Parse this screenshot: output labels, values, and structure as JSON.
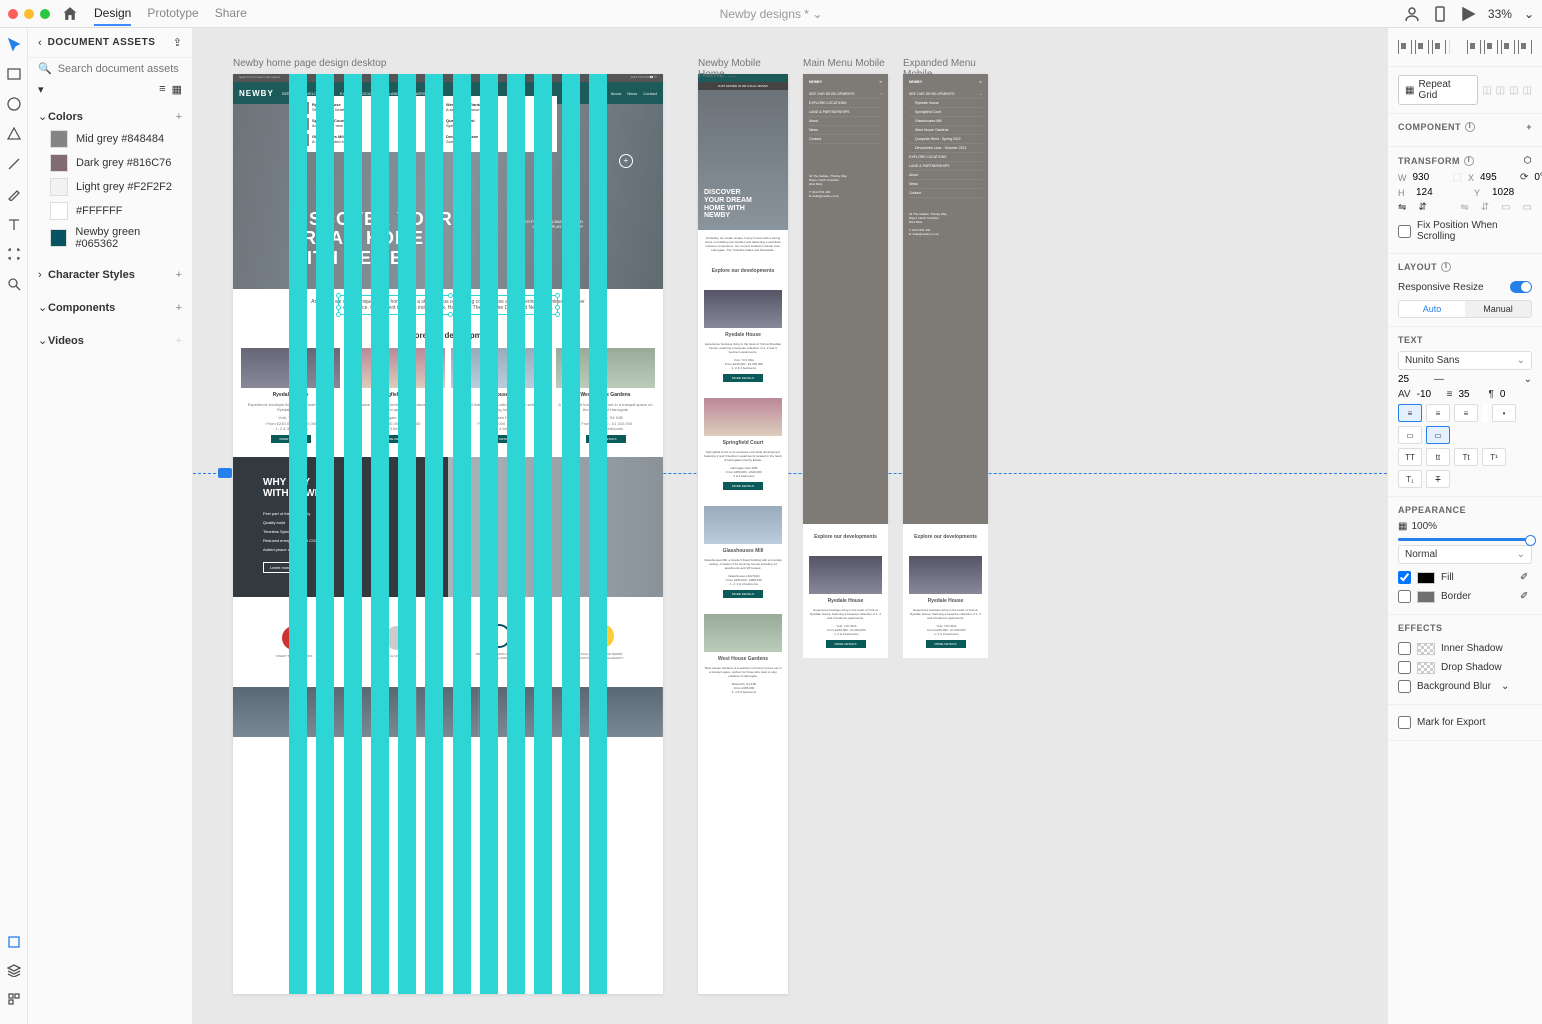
{
  "titlebar": {
    "tabs": [
      "Design",
      "Prototype",
      "Share"
    ],
    "active_tab": "Design",
    "document": "Newby designs *",
    "zoom": "33%"
  },
  "left_panel": {
    "header": "DOCUMENT ASSETS",
    "search_placeholder": "Search document assets",
    "sections": {
      "colors": {
        "title": "Colors",
        "items": [
          {
            "name": "Mid grey #848484",
            "hex": "#848484"
          },
          {
            "name": "Dark grey #816C76",
            "hex": "#816C76"
          },
          {
            "name": "Light grey #F2F2F2",
            "hex": "#F2F2F2"
          },
          {
            "name": "#FFFFFF",
            "hex": "#FFFFFF"
          },
          {
            "name": "Newby green #065362",
            "hex": "#065362"
          }
        ]
      },
      "charstyles": {
        "title": "Character Styles"
      },
      "components": {
        "title": "Components"
      },
      "videos": {
        "title": "Videos"
      }
    }
  },
  "artboards": {
    "a1": "Newby home page design desktop",
    "a2": "Newby Mobile Home ...",
    "a3": "Main Menu Mobile",
    "a4": "Expanded Menu Mobile"
  },
  "content": {
    "logo": "NEWBY",
    "nav": [
      "SEE OUR DEVELOPMENTS",
      "EXPLORE LOCATIONS",
      "LAND & PARTNERSHIPS",
      "About",
      "News",
      "Contact"
    ],
    "dropdown": [
      [
        "Ryedale House",
        "Springfield Court",
        "Glasshouses Mill"
      ],
      [
        "West House Gardens",
        "Quayside West",
        "Devonshire Lane"
      ]
    ],
    "hero": "DISCOVER YOUR\nDREAM HOME\nWITH NEWBY",
    "hero_mobile": "DISCOVER\nYOUR DREAM\nHOME WITH\nNEWBY",
    "intro": "At Newby, we create unique, luxury homes with a strong focus on building communities and delivering a seamless customer experience. Our current locations include York, Harrogate, The Yorkshire Dales and Newcastle.",
    "explore_title": "Explore our developments",
    "cards": [
      {
        "title": "Ryedale House",
        "btn": "MORE DETAILS"
      },
      {
        "title": "Springfield Court",
        "btn": "MORE DETAILS"
      },
      {
        "title": "Glasshouses Mill",
        "btn": "MORE DETAILS"
      },
      {
        "title": "West House Gardens",
        "btn": "MORE DETAILS"
      }
    ],
    "why_title": "WHY BUY\nWITH NEWBY?",
    "why_items": [
      "Feel part of the community",
      "Quality build",
      "Timeless Specification",
      "Reduced energy bills and CO2",
      "Added peace of mind"
    ],
    "why_btn": "Learn more",
    "trust": [
      "FINEST SPECIFICATIONS",
      "BEAUTIFUL UK LOCATIONS",
      "PARTNER YOU WITH A TRUSTED ESTATE AGENT",
      "INCLUDING A 2 YEAR NEWBY CUSTOMER CARE GUARANTY"
    ]
  },
  "menu": {
    "items": [
      "SEE OUR DEVELOPMENTS",
      "EXPLORE LOCATIONS",
      "LAND & PARTNERSHIPS",
      "About",
      "News",
      "Contact"
    ],
    "expanded": [
      "Ryedale House",
      "Springfield Court",
      "Glasshouses Mill",
      "West House Gardens",
      "Quayside West - Spring 2022",
      "Devonshire Lane - Summer 2021",
      "EXPLORE LOCATIONS",
      "LAND & PARTNERSHIPS",
      "About",
      "News",
      "Contact"
    ]
  },
  "right_panel": {
    "repeat": "Repeat Grid",
    "component": "COMPONENT",
    "transform": {
      "title": "TRANSFORM",
      "w": "930",
      "x": "495",
      "h": "124",
      "y": "1028",
      "rotation": "0°"
    },
    "fix_label": "Fix Position When Scrolling",
    "layout": {
      "title": "LAYOUT",
      "responsive": "Responsive Resize",
      "auto": "Auto",
      "manual": "Manual"
    },
    "text": {
      "title": "TEXT",
      "font": "Nunito Sans",
      "size": "25",
      "weight": "—",
      "tracking": "-10",
      "leading": "35",
      "para": "0"
    },
    "appearance": {
      "title": "APPEARANCE",
      "opacity": "100%",
      "blend": "Normal",
      "fill": "Fill",
      "border": "Border",
      "fill_color": "#000000",
      "border_color": "#707070"
    },
    "effects": {
      "title": "EFFECTS",
      "items": [
        "Inner Shadow",
        "Drop Shadow",
        "Background Blur"
      ]
    },
    "export": "Mark for Export"
  }
}
